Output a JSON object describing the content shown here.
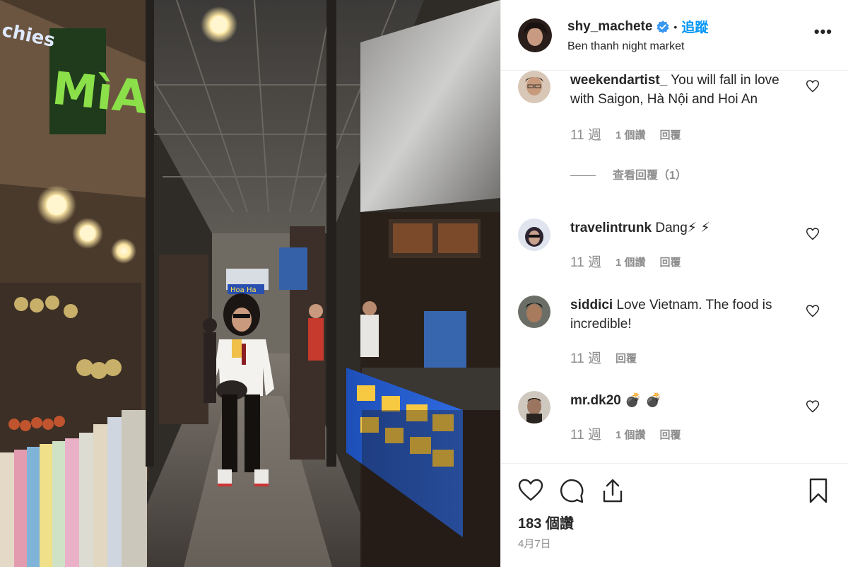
{
  "header": {
    "username": "shy_machete",
    "follow_label": "追蹤",
    "location": "Ben thanh night market",
    "more_label": "•••"
  },
  "photo": {
    "sign_top": "chies",
    "sign_mia": "MìA",
    "sign_blue": "Hoa Ha"
  },
  "comments": [
    {
      "username": "weekendartist_",
      "text": "You will fall in love with Saigon, Hà Nội and Hoi An",
      "time": "11 週",
      "likes": "1 個讚",
      "reply": "回覆",
      "view_replies": "查看回覆（1）"
    },
    {
      "username": "travelintrunk",
      "text": "Dang⚡ ⚡",
      "time": "11 週",
      "likes": "1 個讚",
      "reply": "回覆"
    },
    {
      "username": "siddici",
      "text": "Love Vietnam. The food is incredible!",
      "time": "11 週",
      "reply": "回覆"
    },
    {
      "username": "mr.dk20",
      "text": "💣 💣",
      "time": "11 週",
      "likes": "1 個讚",
      "reply": "回覆"
    }
  ],
  "footer": {
    "likes_count": "183 個讚",
    "date": "4月7日"
  },
  "colors": {
    "accent": "#0095f6",
    "muted": "#8e8e8e",
    "text": "#262626",
    "border": "#efefef"
  }
}
